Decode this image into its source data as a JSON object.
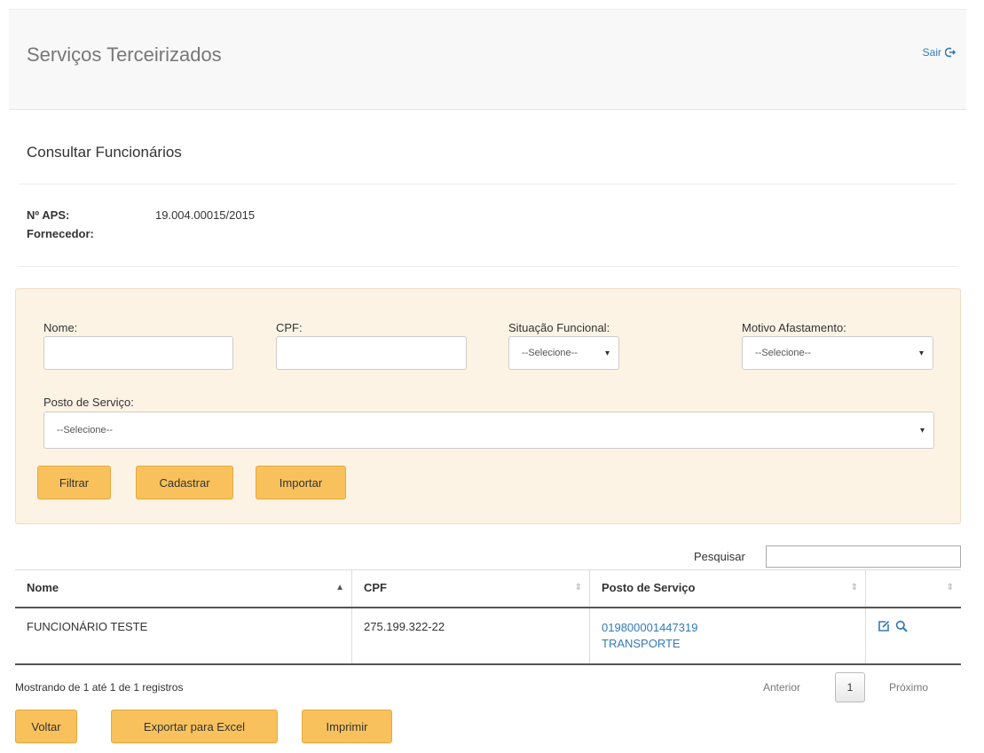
{
  "header": {
    "app_title": "Serviços Terceirizados",
    "logout_label": "Sair"
  },
  "page": {
    "title": "Consultar Funcionários"
  },
  "info": {
    "aps_label": "Nº APS:",
    "aps_value": "19.004.00015/2015",
    "supplier_label": "Fornecedor:"
  },
  "filters": {
    "name_label": "Nome:",
    "name_value": "",
    "cpf_label": "CPF:",
    "cpf_value": "",
    "status_label": "Situação Funcional:",
    "status_selected": "--Selecione--",
    "leave_label": "Motivo Afastamento:",
    "leave_selected": "--Selecione--",
    "post_label": "Posto de Serviço:",
    "post_selected": "--Selecione--"
  },
  "actions": {
    "filter": "Filtrar",
    "register": "Cadastrar",
    "import": "Importar"
  },
  "table": {
    "search_label": "Pesquisar",
    "search_value": "",
    "columns": [
      "Nome",
      "CPF",
      "Posto de Serviço",
      ""
    ],
    "rows": [
      {
        "name": "FUNCIONÁRIO TESTE",
        "cpf": "275.199.322-22",
        "post_code": "019800001447319",
        "post_name": "TRANSPORTE"
      }
    ]
  },
  "pagination": {
    "summary": "Mostrando de 1 até 1 de 1 registros",
    "previous": "Anterior",
    "current_page": "1",
    "next": "Próximo"
  },
  "footer_actions": {
    "back": "Voltar",
    "export": "Exportar para Excel",
    "print": "Imprimir"
  },
  "colors": {
    "button": "#f8c15c",
    "panel": "#fcf3e4",
    "link": "#337ab7",
    "header_bg": "#f8f8f8"
  },
  "icons": {
    "logout": "logout-icon",
    "edit": "edit-icon",
    "view": "search-icon",
    "sort": "sort-icon"
  }
}
